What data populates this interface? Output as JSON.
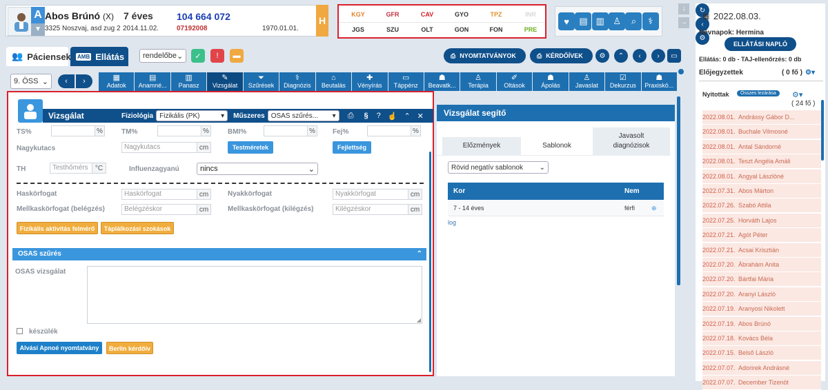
{
  "patient": {
    "name": "Abos Brúnó",
    "gender_mark": "(X)",
    "age": "7 éves",
    "taj": "104 664 072",
    "address": "3325 Noszvaj, asd zug 2",
    "date": "2014.11.02.",
    "number": "07192008",
    "birth": "1970.01.01.",
    "badge": "A",
    "h_label": "H"
  },
  "codes": [
    {
      "label": "KGY",
      "color": "#e0802a"
    },
    {
      "label": "GFR",
      "color": "#c03040"
    },
    {
      "label": "CAV",
      "color": "#d0202a"
    },
    {
      "label": "GYO",
      "color": "#333333"
    },
    {
      "label": "TPZ",
      "color": "#e0902a"
    },
    {
      "label": "INR",
      "color": "#d8d8d8"
    },
    {
      "label": "JGS",
      "color": "#333333"
    },
    {
      "label": "SZU",
      "color": "#333333"
    },
    {
      "label": "OLT",
      "color": "#333333"
    },
    {
      "label": "GON",
      "color": "#333333"
    },
    {
      "label": "FON",
      "color": "#333333"
    },
    {
      "label": "PRE",
      "color": "#6ab020"
    }
  ],
  "tabs": {
    "pacientsek": "Páciensek",
    "ellatas": "Ellátás",
    "amb": "AMB"
  },
  "rendelobe": "rendelőbe",
  "toolbar": {
    "nyomtatvanyok": "NYOMTATVÁNYOK",
    "kerdoivek": "KÉRDŐÍVEK"
  },
  "session_select": "9. ÖSS",
  "nav": [
    {
      "label": "Adatok",
      "glyph": "▦"
    },
    {
      "label": "Anamné...",
      "glyph": "▤"
    },
    {
      "label": "Panasz",
      "glyph": "▥"
    },
    {
      "label": "Vizsgálat",
      "glyph": "✎",
      "active": true
    },
    {
      "label": "Szűrések",
      "glyph": "⏷"
    },
    {
      "label": "Diagnózis",
      "glyph": "⚕"
    },
    {
      "label": "Beutalás",
      "glyph": "⌂"
    },
    {
      "label": "Vényírás",
      "glyph": "✚"
    },
    {
      "label": "Táppénz",
      "glyph": "▭"
    },
    {
      "label": "Beavatk...",
      "glyph": "☗"
    },
    {
      "label": "Terápia",
      "glyph": "♙"
    },
    {
      "label": "Oltások",
      "glyph": "✐"
    },
    {
      "label": "Ápolás",
      "glyph": "☗"
    },
    {
      "label": "Javaslat",
      "glyph": "♙"
    },
    {
      "label": "Dekurzus",
      "glyph": "☑"
    },
    {
      "label": "Praxiskö...",
      "glyph": "☗"
    }
  ],
  "vizsgalat": {
    "title": "Vizsgálat",
    "fiziologia_label": "Fiziológia",
    "fiziologia_value": "Fizikális (PK)",
    "muszeres_label": "Műszeres",
    "muszeres_value": "OSAS szűrés...",
    "section_mark": "§",
    "ts_label": "TS%",
    "tm_label": "TM%",
    "bmi_label": "BMI%",
    "fej_label": "Fej%",
    "pct": "%",
    "nagykutacs_label": "Nagykutacs",
    "nagykutacs_ph": "Nagykutacs",
    "cm": "cm",
    "testmeretek": "Testméretek",
    "fejlettseg": "Fejlettség",
    "th_label": "TH",
    "th_ph": "Testhőmérs",
    "celsius": "°C",
    "influenza_label": "Influenzagyanú",
    "influenza_value": "nincs",
    "has_label": "Haskörfogat",
    "has_ph": "Haskörfogat",
    "nyak_label": "Nyakkörfogat",
    "nyak_ph": "Nyakkörfogat",
    "mell_be_label": "Mellkaskörfogat (belégzés)",
    "mell_be_ph": "Belégzéskor",
    "mell_ki_label": "Mellkaskörfogat (kilégzés)",
    "mell_ki_ph": "Kilégzéskor",
    "fizikalis_btn": "Fizikális aktivitás felmérő",
    "taplalkozasi_btn": "Táplálkozási szokások",
    "osas_title": "OSAS szűrés",
    "osas_label": "OSAS vizsgálat",
    "keszulek": "készülék",
    "alvasi_btn": "Alvási Apnoé nyomtatvány",
    "berlin_btn": "Berlin kérdőív"
  },
  "helper": {
    "title": "Vizsgálat segítő",
    "tab_elozmenyek": "Előzmények",
    "tab_sablonok": "Sablonok",
    "tab_javasolt": "Javasolt diagnózisok",
    "template_select": "Rövid negatív sablonok",
    "col_kor": "Kor",
    "col_nem": "Nem",
    "row_kor": "7 - 14 éves",
    "row_nem": "férfi",
    "log": "log"
  },
  "right": {
    "date": "2022.08.03.",
    "nevnapok": "Névnapok: Hermina",
    "naplo_btn": "ELLÁTÁSI NAPLÓ",
    "ellatas_line": "Ellátás: 0 db - TAJ-ellenőrzés: 0 db",
    "elojegyzettek": "Előjegyzettek",
    "elojegyzettek_count": "( 0 fő )",
    "nyitottak": "Nyitottak",
    "osszes_lezarasa": "Összes lezárása",
    "nyitottak_count": "( 24 fő )",
    "rows": [
      {
        "date": "2022.08.01.",
        "name": "Andrássy Gábor D..."
      },
      {
        "date": "2022.08.01.",
        "name": "Buchale Vilmosné"
      },
      {
        "date": "2022.08.01.",
        "name": "Antal Sándorné"
      },
      {
        "date": "2022.08.01.",
        "name": "Teszt Angéla Amáli"
      },
      {
        "date": "2022.08.01.",
        "name": "Angyal Lászlóné"
      },
      {
        "date": "2022.07.31.",
        "name": "Abos Márton"
      },
      {
        "date": "2022.07.26.",
        "name": "Szabó Attila"
      },
      {
        "date": "2022.07.25.",
        "name": "Horváth Lajos"
      },
      {
        "date": "2022.07.21.",
        "name": "Agót Péter"
      },
      {
        "date": "2022.07.21.",
        "name": "Acsai Krisztián"
      },
      {
        "date": "2022.07.20.",
        "name": "Ábrahám Anita"
      },
      {
        "date": "2022.07.20.",
        "name": "Bártfai Mária"
      },
      {
        "date": "2022.07.20.",
        "name": "Aranyi László"
      },
      {
        "date": "2022.07.19.",
        "name": "Aranyosi Nikolett"
      },
      {
        "date": "2022.07.19.",
        "name": "Abos Brúnó"
      },
      {
        "date": "2022.07.18.",
        "name": "Kovács Béla"
      },
      {
        "date": "2022.07.15.",
        "name": "Belső László"
      },
      {
        "date": "2022.07.07.",
        "name": "Adorirek Andrásné"
      },
      {
        "date": "2022.07.07.",
        "name": "December Tizenöt"
      }
    ]
  }
}
